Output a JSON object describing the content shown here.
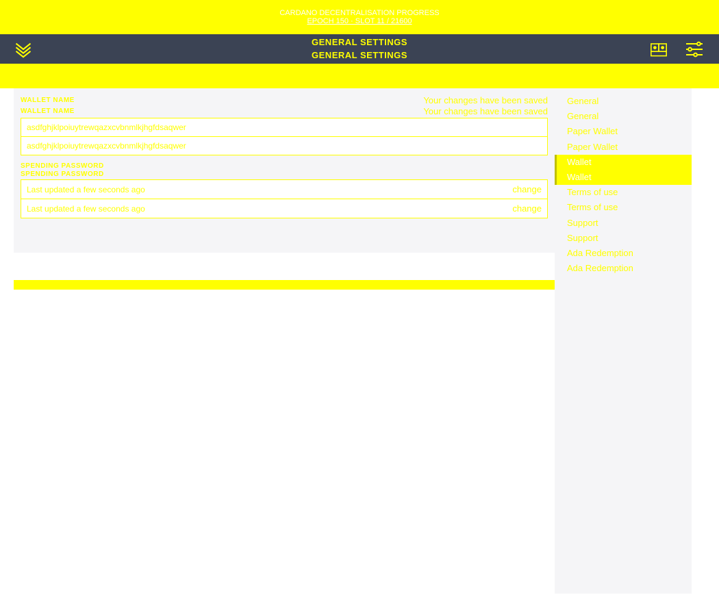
{
  "banner": {
    "line1": "CARDANO DECENTRALISATION PROGRESS",
    "line2": "EPOCH 150 · SLOT 11 / 21600"
  },
  "header": {
    "title": "GENERAL SETTINGS"
  },
  "content": {
    "wallet_name_label": "WALLET NAME",
    "saved_message": "Your changes have been saved",
    "wallet_name_value": "asdfghjklpoiuytrewqazxcvbnmlkjhgfdsaqwer",
    "spending_password_label": "SPENDING PASSWORD",
    "password_updated": "Last updated a few seconds ago",
    "change_label": "change"
  },
  "sidebar": {
    "items": [
      {
        "label": "General",
        "active": false
      },
      {
        "label": "General",
        "active": false
      },
      {
        "label": "Paper Wallet",
        "active": false
      },
      {
        "label": "Paper Wallet",
        "active": false
      },
      {
        "label": "Wallet",
        "active": true
      },
      {
        "label": "Wallet",
        "active": true
      },
      {
        "label": "Terms of use",
        "active": false
      },
      {
        "label": "Terms of use",
        "active": false
      },
      {
        "label": "Support",
        "active": false
      },
      {
        "label": "Support",
        "active": false
      },
      {
        "label": "Ada Redemption",
        "active": false
      },
      {
        "label": "Ada Redemption",
        "active": false
      }
    ]
  }
}
